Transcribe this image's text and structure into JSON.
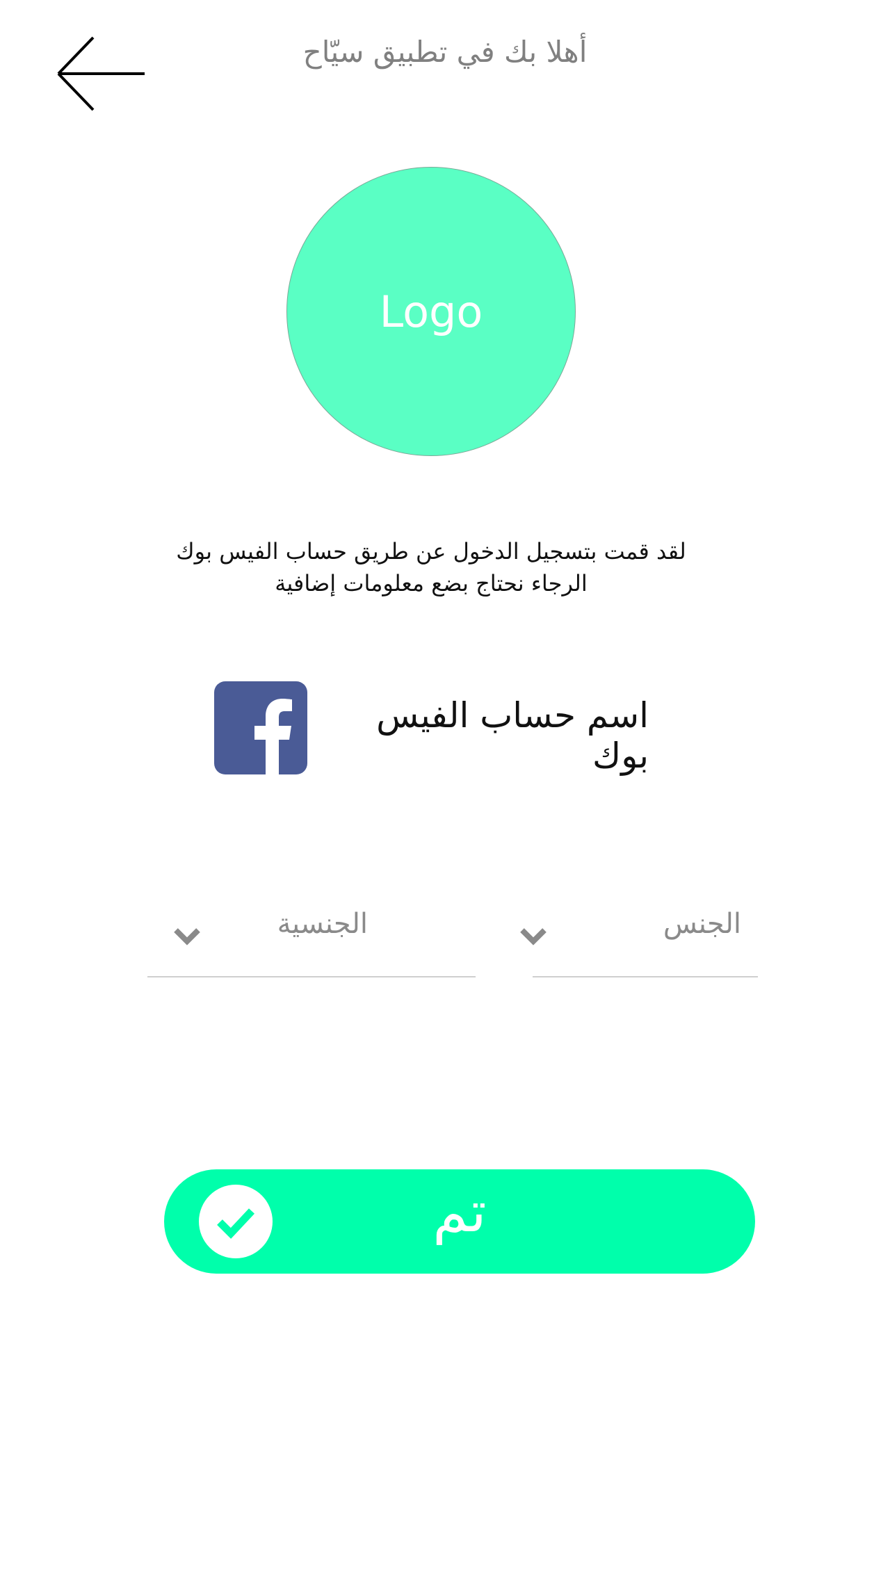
{
  "header": {
    "title": "أهلا بك في تطبيق سيّاح"
  },
  "logo": {
    "text": "Logo"
  },
  "info": {
    "line1": "لقد قمت بتسجيل الدخول عن طريق حساب الفيس بوك",
    "line2": "الرجاء نحتاج بضع معلومات إضافية"
  },
  "facebook": {
    "account_name": "اسم حساب الفيس بوك",
    "icon": "facebook-icon"
  },
  "form": {
    "nationality": {
      "label": "الجنسية",
      "icon": "chevron-down-icon"
    },
    "gender": {
      "label": "الجنس",
      "icon": "chevron-down-icon"
    }
  },
  "done_button": {
    "label": "تم",
    "icon": "checkmark-icon"
  },
  "colors": {
    "logo": "#5affc4",
    "button": "#00ffab",
    "facebook": "#4a5b96",
    "muted_text": "#808080"
  }
}
